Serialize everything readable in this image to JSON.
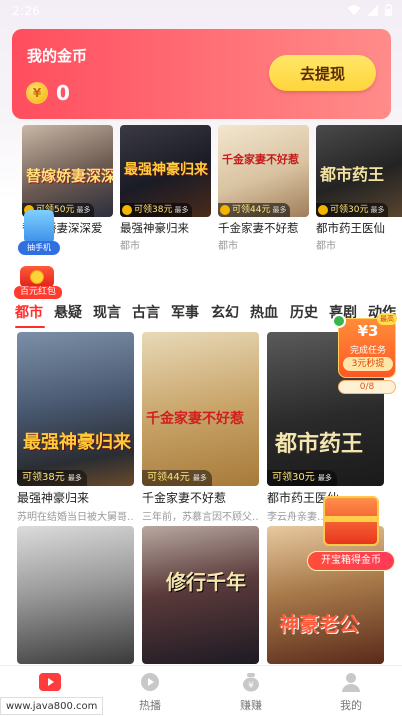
{
  "status_bar": {
    "time": "2:26"
  },
  "coin_card": {
    "title": "我的金币",
    "coin_symbol": "¥",
    "coin_value": "0",
    "withdraw_label": "去提现"
  },
  "featured": [
    {
      "title": "替嫁娇妻深深爱",
      "category": "",
      "tag": "可领50元",
      "tag_extra": "最多",
      "poster_text": "替嫁娇妻深深爱"
    },
    {
      "title": "最强神豪归来",
      "category": "都市",
      "tag": "可领38元",
      "tag_extra": "最多",
      "poster_text": "最强神豪归来"
    },
    {
      "title": "千金家妻不好惹",
      "category": "都市",
      "tag": "可领44元",
      "tag_extra": "最多",
      "poster_text": "千金家妻不好惹"
    },
    {
      "title": "都市药王医仙",
      "category": "都市",
      "tag": "可领30元",
      "tag_extra": "最多",
      "poster_text": "都市药王"
    }
  ],
  "phone_badge": {
    "label": "抽手机"
  },
  "red_packet": {
    "label": "百元红包"
  },
  "categories": [
    "都市",
    "悬疑",
    "现言",
    "古言",
    "军事",
    "玄幻",
    "热血",
    "历史",
    "喜剧",
    "动作"
  ],
  "active_category": "都市",
  "grid": [
    {
      "title": "最强神豪归来",
      "desc": "苏明在结婚当日被大舅哥…",
      "tag": "可领38元",
      "tag_extra": "最多",
      "poster_text": "最强神豪归来"
    },
    {
      "title": "千金家妻不好惹",
      "desc": "三年前，苏慕言因不顾父…",
      "tag": "可领44元",
      "tag_extra": "最多",
      "poster_text": "千金家妻不好惹"
    },
    {
      "title": "都市药王医仙",
      "desc": "李云舟亲妻…",
      "tag": "可领30元",
      "tag_extra": "最多",
      "poster_text": "都市药王"
    },
    {
      "title": "",
      "desc": "",
      "tag": "",
      "tag_extra": "",
      "poster_text": ""
    },
    {
      "title": "",
      "desc": "",
      "tag": "",
      "tag_extra": "",
      "poster_text": "修行千年"
    },
    {
      "title": "",
      "desc": "",
      "tag": "",
      "tag_extra": "",
      "poster_text": "神豪老公"
    }
  ],
  "task_widget": {
    "amount": "¥3",
    "badge": "最高",
    "line1": "完成任务",
    "line2": "3元秒提",
    "progress": "0/8"
  },
  "treasure": {
    "label": "开宝箱得金币"
  },
  "bottom_nav": [
    {
      "label": "",
      "icon": "play-video-icon",
      "active": true
    },
    {
      "label": "热播",
      "icon": "play-circle-icon",
      "active": false
    },
    {
      "label": "赚赚",
      "icon": "money-bag-icon",
      "active": false
    },
    {
      "label": "我的",
      "icon": "user-icon",
      "active": false
    }
  ],
  "watermark": "www.java800.com",
  "colors": {
    "accent": "#ff2e2e",
    "card_start": "#ff4d5e",
    "card_end": "#ff8c8a",
    "button": "#ffd53a"
  }
}
